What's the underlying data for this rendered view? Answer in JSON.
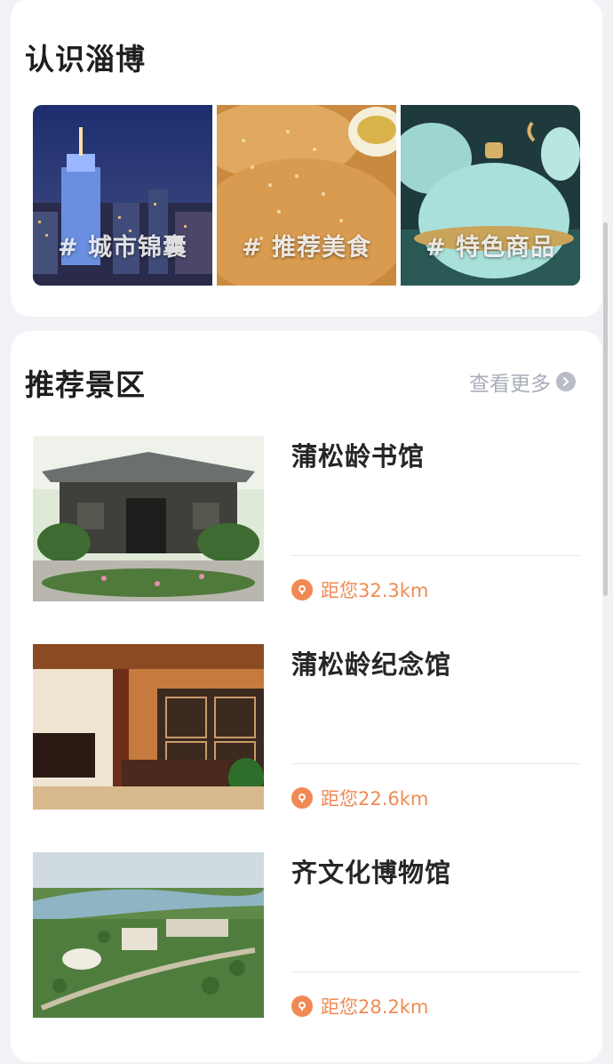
{
  "know": {
    "title": "认识淄博",
    "tiles": [
      {
        "label": "# 城市锦囊"
      },
      {
        "label": "# 推荐美食"
      },
      {
        "label": "# 特色商品"
      }
    ]
  },
  "scenic": {
    "title": "推荐景区",
    "more_label": "查看更多",
    "spots": [
      {
        "name": "蒲松龄书馆",
        "distance": "距您32.3km"
      },
      {
        "name": "蒲松龄纪念馆",
        "distance": "距您22.6km"
      },
      {
        "name": "齐文化博物馆",
        "distance": "距您28.2km"
      }
    ]
  },
  "colors": {
    "accent": "#f08a54",
    "muted": "#a9adb8"
  }
}
